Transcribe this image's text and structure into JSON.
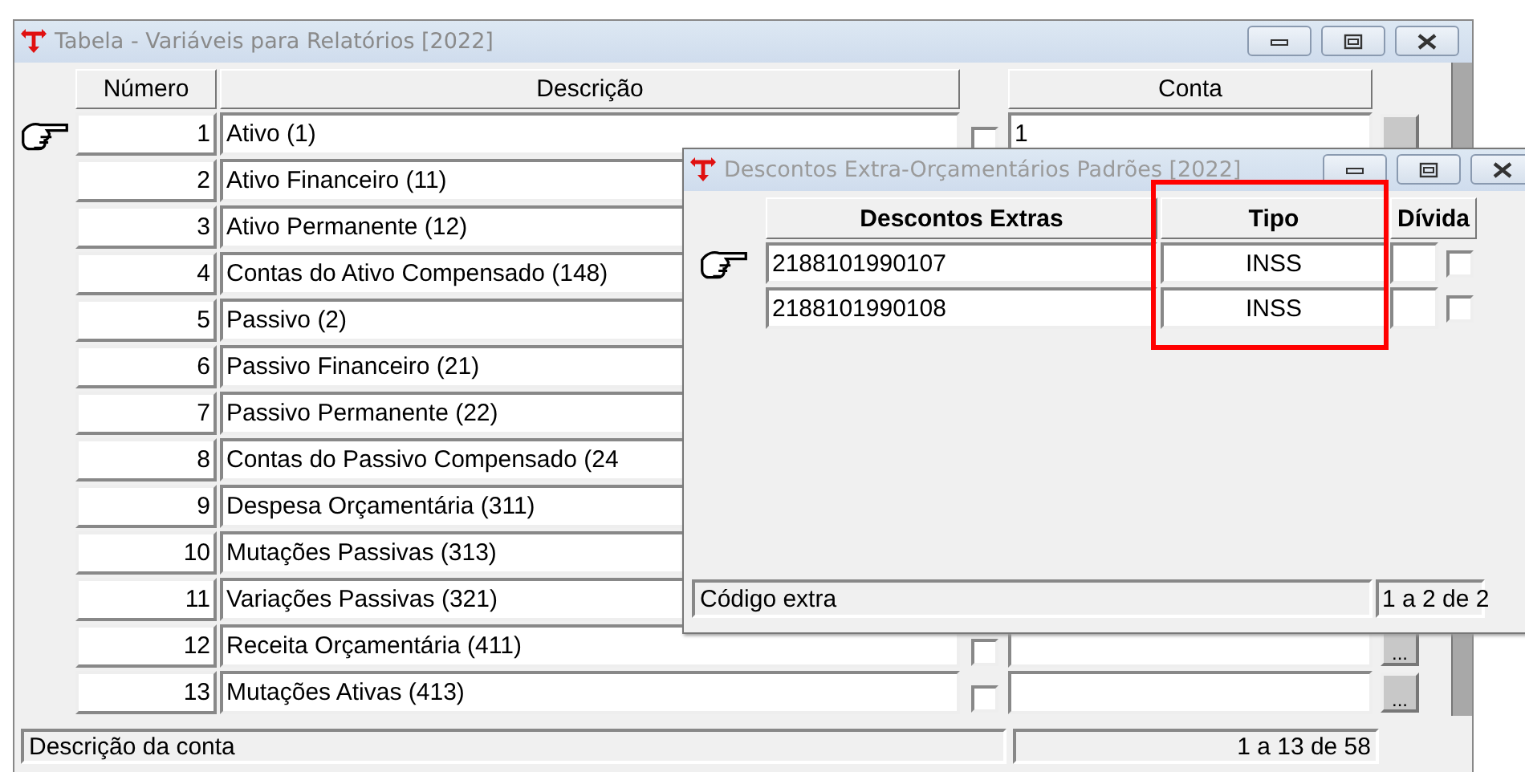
{
  "window": {
    "title": "Tabela - Variáveis para Relatórios [2022]"
  },
  "table": {
    "columns": [
      "Número",
      "Descrição",
      "Conta"
    ],
    "rows": [
      {
        "number": "1",
        "description": "Ativo (1)",
        "selected": true,
        "kind": "full",
        "checked": false,
        "conta": "1"
      },
      {
        "number": "2",
        "description": "Ativo Financeiro (11)",
        "selected": false,
        "kind": "covered"
      },
      {
        "number": "3",
        "description": "Ativo Permanente (12)",
        "selected": false,
        "kind": "covered"
      },
      {
        "number": "4",
        "description": "Contas do Ativo Compensado (148)",
        "selected": false,
        "kind": "covered"
      },
      {
        "number": "5",
        "description": "Passivo (2)",
        "selected": false,
        "kind": "covered"
      },
      {
        "number": "6",
        "description": "Passivo Financeiro (21)",
        "selected": false,
        "kind": "covered"
      },
      {
        "number": "7",
        "description": "Passivo Permanente (22)",
        "selected": false,
        "kind": "covered"
      },
      {
        "number": "8",
        "description": "Contas do Passivo Compensado (24",
        "selected": false,
        "kind": "covered"
      },
      {
        "number": "9",
        "description": "Despesa Orçamentária (311)",
        "selected": false,
        "kind": "covered"
      },
      {
        "number": "10",
        "description": "Mutações Passivas (313)",
        "selected": false,
        "kind": "covered"
      },
      {
        "number": "11",
        "description": "Variações Passivas (321)",
        "selected": false,
        "kind": "covered"
      },
      {
        "number": "12",
        "description": "Receita Orçamentária (411)",
        "selected": false,
        "kind": "full",
        "checked": false,
        "button": "..."
      },
      {
        "number": "13",
        "description": "Mutações Ativas (413)",
        "selected": false,
        "kind": "full",
        "checked": false,
        "button": "..."
      }
    ]
  },
  "status_bar": {
    "label": "Descrição da conta",
    "count": "1 a 13 de 58"
  },
  "dialog": {
    "title": "Descontos Extra-Orçamentários Padrões [2022]",
    "columns": [
      "Descontos Extras",
      "Tipo",
      "Dívida"
    ],
    "rows": [
      {
        "code": "2188101990107",
        "tipo": "INSS",
        "selected": true,
        "checked": false
      },
      {
        "code": "2188101990108",
        "tipo": "INSS",
        "selected": false,
        "checked": false
      }
    ],
    "status_bar": {
      "label": "Código extra",
      "count": "1 a 2 de 2"
    }
  }
}
